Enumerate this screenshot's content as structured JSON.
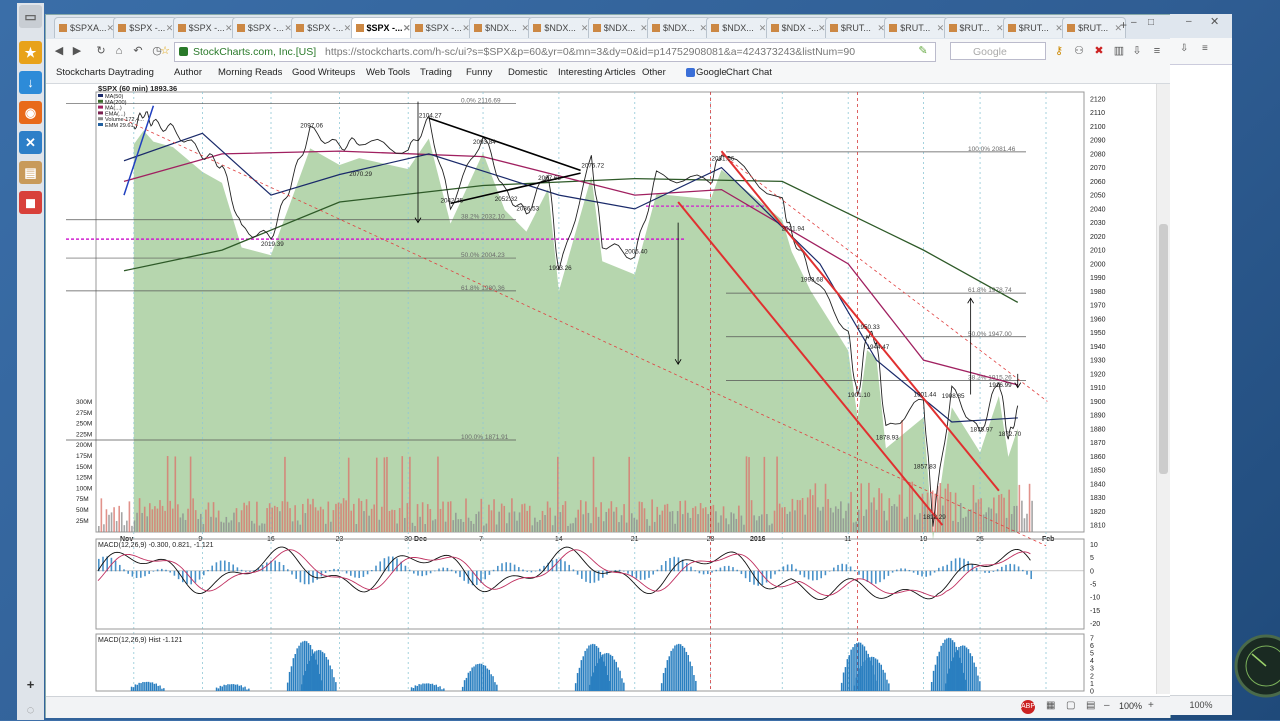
{
  "browser": {
    "tabs": [
      "$SPXA...",
      "$SPX -...",
      "$SPX -...",
      "$SPX -...",
      "$SPX -...",
      "$SPX -...",
      "$SPX -...",
      "$NDX...",
      "$NDX...",
      "$NDX...",
      "$NDX...",
      "$NDX...",
      "$NDX -...",
      "$RUT...",
      "$RUT...",
      "$RUT...",
      "$RUT...",
      "$RUT..."
    ],
    "active_tab": 5,
    "site_identity": "StockCharts.com, Inc.[US]",
    "url": "https://stockcharts.com/h-sc/ui?s=$SPX&p=60&yr=0&mn=3&dy=0&id=p14752908081&a=424373243&listNum=90",
    "search_placeholder": "Google",
    "zoom": "100%",
    "right_zoom": "100%"
  },
  "bookmarks": [
    "Stockcharts",
    "Daytrading",
    "Author",
    "Morning Reads",
    "Good Writeups",
    "Web Tools",
    "Trading",
    "Funny",
    "Domestic",
    "Interesting Articles",
    "Other",
    "Google",
    "Chart Chat"
  ],
  "chart_data": [
    {
      "type": "line",
      "title": "$SPX (60 min) 1893.36",
      "legend": [
        "MA(50)",
        "MA(200)",
        "MA(...)",
        "EMA(...)",
        "Volume 172,4...",
        "EMM 29.61"
      ],
      "x_tick_labels": [
        "Nov",
        "9",
        "16",
        "23",
        "30",
        "Dec",
        "7",
        "14",
        "21",
        "28",
        "2016",
        "11",
        "19",
        "25",
        "Feb"
      ],
      "y_tick_labels": [
        "2120",
        "2110",
        "2100",
        "2090",
        "2080",
        "2070",
        "2060",
        "2050",
        "2040",
        "2030",
        "2020",
        "2010",
        "2000",
        "1990",
        "1980",
        "1970",
        "1960",
        "1950",
        "1940",
        "1930",
        "1920",
        "1910",
        "1900",
        "1890",
        "1880",
        "1870",
        "1860",
        "1850",
        "1840",
        "1830",
        "1820",
        "1810"
      ],
      "ylim": [
        1805,
        2125
      ],
      "volume_tick_labels": [
        "300M",
        "275M",
        "250M",
        "225M",
        "200M",
        "175M",
        "150M",
        "125M",
        "100M",
        "75M",
        "50M",
        "25M"
      ],
      "price_path": [
        {
          "x": "Nov 2",
          "y": 2100
        },
        {
          "x": "Nov 3",
          "y": 2110
        },
        {
          "x": "Nov 4",
          "y": 2102
        },
        {
          "x": "Nov 6",
          "y": 2098
        },
        {
          "x": "Nov 9",
          "y": 2080
        },
        {
          "x": "Nov 11",
          "y": 2072
        },
        {
          "x": "Nov 13",
          "y": 2025
        },
        {
          "x": "Nov 16",
          "y": 2019.39
        },
        {
          "x": "Nov 18",
          "y": 2058
        },
        {
          "x": "Nov 20",
          "y": 2097.06
        },
        {
          "x": "Nov 23",
          "y": 2085
        },
        {
          "x": "Nov 25",
          "y": 2090
        },
        {
          "x": "Nov 30",
          "y": 2082
        },
        {
          "x": "Dec 2",
          "y": 2104.27
        },
        {
          "x": "Dec 4",
          "y": 2042.35
        },
        {
          "x": "Dec 7",
          "y": 2093.84
        },
        {
          "x": "Dec 9",
          "y": 2052.32
        },
        {
          "x": "Dec 11",
          "y": 2036.53
        },
        {
          "x": "Dec 13",
          "y": 2067.65
        },
        {
          "x": "Dec 14",
          "y": 1993.26
        },
        {
          "x": "Dec 17",
          "y": 2076.72
        },
        {
          "x": "Dec 18",
          "y": 2015
        },
        {
          "x": "Dec 21",
          "y": 2005.4
        },
        {
          "x": "Dec 23",
          "y": 2064
        },
        {
          "x": "Dec 28",
          "y": 2060
        },
        {
          "x": "Dec 29",
          "y": 2081.56
        },
        {
          "x": "Jan 4",
          "y": 2045
        },
        {
          "x": "Jan 5",
          "y": 2021.94
        },
        {
          "x": "Jan 7",
          "y": 1993.68
        },
        {
          "x": "Jan 11",
          "y": 1950
        },
        {
          "x": "Jan 12",
          "y": 1901.1
        },
        {
          "x": "Jan 13",
          "y": 1950.33
        },
        {
          "x": "Jan 14",
          "y": 1944.47
        },
        {
          "x": "Jan 15",
          "y": 1878.93
        },
        {
          "x": "Jan 19",
          "y": 1901.44
        },
        {
          "x": "Jan 20",
          "y": 1812.29
        },
        {
          "x": "Jan 22",
          "y": 1908.85
        },
        {
          "x": "Jan 25",
          "y": 1875.97
        },
        {
          "x": "Jan 27",
          "y": 1916.99
        },
        {
          "x": "Jan 28",
          "y": 1872.7
        },
        {
          "x": "Jan 29",
          "y": 1893.36
        }
      ],
      "price_annotations": [
        {
          "label": "2019.39",
          "x": "Nov 16",
          "y": 2019.39
        },
        {
          "label": "2097.06",
          "x": "Nov 20",
          "y": 2097.06
        },
        {
          "label": "2070.29",
          "x": "Nov 25",
          "y": 2070.29
        },
        {
          "label": "2104.27",
          "x": "Dec 2",
          "y": 2104.27
        },
        {
          "label": "2093.84",
          "x": "Dec 7",
          "y": 2093.84
        },
        {
          "label": "2042.35",
          "x": "Dec 4",
          "y": 2042.35
        },
        {
          "label": "2052.32",
          "x": "Dec 9",
          "y": 2052.32
        },
        {
          "label": "2036.53",
          "x": "Dec 11",
          "y": 2036.53
        },
        {
          "label": "2067.65",
          "x": "Dec 13",
          "y": 2067.65
        },
        {
          "label": "1993.26",
          "x": "Dec 14",
          "y": 1993.26
        },
        {
          "label": "2076.72",
          "x": "Dec 17",
          "y": 2076.72
        },
        {
          "label": "2005.40",
          "x": "Dec 21",
          "y": 2005.4
        },
        {
          "label": "2081.56",
          "x": "Dec 29",
          "y": 2081.56
        },
        {
          "label": "2021.94",
          "x": "Jan 5",
          "y": 2021.94
        },
        {
          "label": "1993.68",
          "x": "Jan 7",
          "y": 1993.68
        },
        {
          "label": "1950.33",
          "x": "Jan 13",
          "y": 1950.33
        },
        {
          "label": "1944.47",
          "x": "Jan 14",
          "y": 1944.47
        },
        {
          "label": "1901.10",
          "x": "Jan 12",
          "y": 1901.1
        },
        {
          "label": "1878.93",
          "x": "Jan 15",
          "y": 1878.93
        },
        {
          "label": "1901.44",
          "x": "Jan 19",
          "y": 1901.44
        },
        {
          "label": "1857.83",
          "x": "Jan 19",
          "y": 1857.83
        },
        {
          "label": "1812.29",
          "x": "Jan 20",
          "y": 1812.29
        },
        {
          "label": "1908.85",
          "x": "Jan 22",
          "y": 1908.85
        },
        {
          "label": "1875.97",
          "x": "Jan 25",
          "y": 1875.97
        },
        {
          "label": "1916.99",
          "x": "Jan 27",
          "y": 1916.99
        },
        {
          "label": "1872.70",
          "x": "Jan 28",
          "y": 1872.7
        }
      ],
      "fib_levels": [
        {
          "label": "0.0% 2116.69",
          "y": 2116.69
        },
        {
          "label": "38.2% 2032.10",
          "y": 2032.1
        },
        {
          "label": "50.0% 2004.23",
          "y": 2004.23
        },
        {
          "label": "61.8% 1980.36",
          "y": 1980.36
        },
        {
          "label": "100.0% 1871.91",
          "y": 1871.91
        },
        {
          "label": "100.0% 2081.46",
          "y": 2081.46
        },
        {
          "label": "61.8% 1978.74",
          "y": 1978.74
        },
        {
          "label": "50.0% 1947.00",
          "y": 1947.0
        },
        {
          "label": "38.2% 1915.26",
          "y": 1915.26
        }
      ],
      "series": [
        {
          "name": "MA(50)",
          "color": "#1a2a6a"
        },
        {
          "name": "MA(200)",
          "color": "#3a6a2a"
        },
        {
          "name": "EMA",
          "color": "#a02060"
        }
      ]
    },
    {
      "type": "line",
      "title": "MACD(12,26,9) -0.300, 0.821, -1.121",
      "y_tick_labels": [
        "10",
        "5",
        "0",
        "-5",
        "-10",
        "-15",
        "-20"
      ],
      "ylim": [
        -22,
        12
      ]
    },
    {
      "type": "bar",
      "title": "MACD(12,26,9) Hist -1.121",
      "y_tick_labels": [
        "7",
        "6",
        "5",
        "4",
        "3",
        "2",
        "1",
        "0"
      ],
      "ylim": [
        0,
        7.5
      ]
    }
  ]
}
